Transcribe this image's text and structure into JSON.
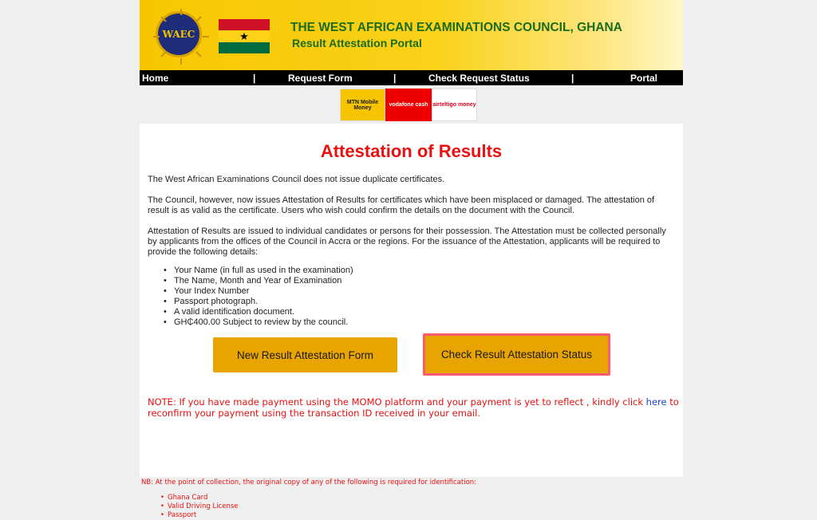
{
  "header": {
    "title": "THE WEST AFRICAN EXAMINATIONS COUNCIL, GHANA",
    "subtitle": "Result Attestation Portal",
    "logo_text": "WAEC",
    "flag_star": "★"
  },
  "nav": {
    "items": [
      "Home",
      "Request Form",
      "Check Request Status",
      "Portal"
    ],
    "separator": "|"
  },
  "payments": {
    "mtn": "MTN Mobile Money",
    "vodafone": "vodafone cash",
    "airtel": "airteltigo money"
  },
  "main": {
    "title": "Attestation of Results",
    "para1": "The West African Examinations Council does not issue duplicate certificates.",
    "para2": "The Council, however, now issues Attestation of Results for certificates which have been misplaced or damaged. The attestation of result is as valid as the certificate. Users who wish could confirm the details on the document with the Council.",
    "para3": "Attestation of Results are issued to individual candidates or persons for their possession. The Attestation must be collected personally by applicants from the offices of the Council in Accra or the regions. For the issuance of the Attestation, applicants will be required to provide the following details:",
    "requirements": [
      "Your Name (in full as used in the examination)",
      "The Name, Month and Year of Examination",
      "Your Index Number",
      "Passport photograph.",
      "A valid identification document.",
      "GH₵400.00 Subject to review by the council."
    ],
    "btn_new": "New Result Attestation Form",
    "btn_check": "Check Result Attestation Status",
    "note_before": "NOTE: If you have made payment using the MOMO platform and your payment is yet to reflect , kindly click ",
    "note_link": "here",
    "note_after": " to reconfirm your payment using the transaction ID received in your email."
  },
  "footer": {
    "nb": "NB: At the point of collection, the original copy of any of the following is required for identification:",
    "ids": [
      "Ghana Card",
      "Valid Driving License",
      "Passport"
    ]
  },
  "colors": {
    "accent_red": "#e81010",
    "header_green": "#1a6b1a",
    "button_orange": "#e8a400",
    "highlight": "#ff5a6e"
  }
}
